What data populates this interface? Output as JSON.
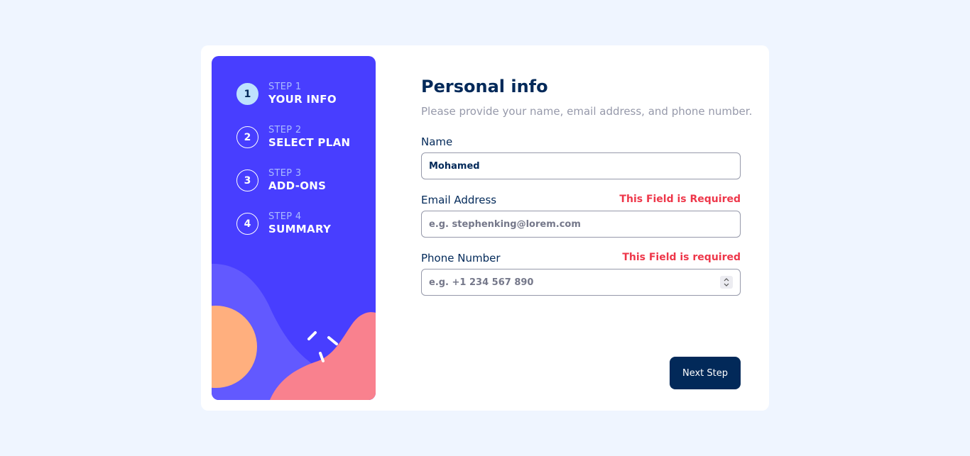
{
  "sidebar": {
    "steps": [
      {
        "number": "1",
        "small": "STEP 1",
        "big": "YOUR INFO",
        "active": true
      },
      {
        "number": "2",
        "small": "STEP 2",
        "big": "SELECT PLAN",
        "active": false
      },
      {
        "number": "3",
        "small": "STEP 3",
        "big": "ADD-ONS",
        "active": false
      },
      {
        "number": "4",
        "small": "STEP 4",
        "big": "SUMMARY",
        "active": false
      }
    ]
  },
  "form": {
    "title": "Personal info",
    "subtitle": "Please provide your name, email address, and phone number.",
    "name": {
      "label": "Name",
      "value": "Mohamed",
      "placeholder": ""
    },
    "email": {
      "label": "Email Address",
      "value": "",
      "placeholder": "e.g. stephenking@lorem.com",
      "error": "This Field is Required"
    },
    "phone": {
      "label": "Phone Number",
      "value": "",
      "placeholder": "e.g. +1 234 567 890",
      "error": "This Field is required"
    },
    "next_label": "Next Step"
  },
  "colors": {
    "sidebar_bg": "#483eff",
    "primary_text": "#022959",
    "error": "#ee374a",
    "button_bg": "#022959"
  }
}
